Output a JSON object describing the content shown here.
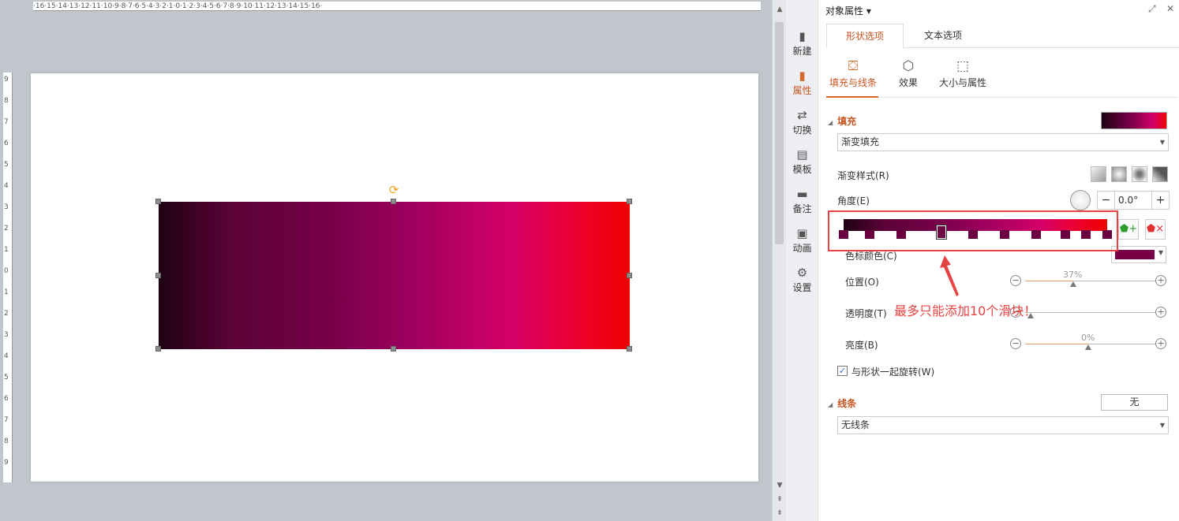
{
  "ruler": {
    "h_ticks": "·16·15·14·13·12·11·10·9·8·7·6·5·4·3·2·1·0·1·2·3·4·5·6·7·8·9·10·11·12·13·14·15·16·",
    "v_ticks": [
      "9",
      "8",
      "7",
      "6",
      "5",
      "4",
      "3",
      "2",
      "1",
      "0",
      "1",
      "2",
      "3",
      "4",
      "5",
      "6",
      "7",
      "8",
      "9"
    ]
  },
  "sidebar": {
    "items": [
      {
        "label": "新建",
        "icon": "new-file-icon"
      },
      {
        "label": "属性",
        "icon": "properties-icon"
      },
      {
        "label": "切换",
        "icon": "transition-icon"
      },
      {
        "label": "模板",
        "icon": "template-icon"
      },
      {
        "label": "备注",
        "icon": "notes-icon"
      },
      {
        "label": "动画",
        "icon": "animation-icon"
      },
      {
        "label": "设置",
        "icon": "settings-icon"
      }
    ]
  },
  "panel": {
    "title": "对象属性",
    "tabs": [
      "形状选项",
      "文本选项"
    ],
    "subtabs": [
      "填充与线条",
      "效果",
      "大小与属性"
    ],
    "fill": {
      "section_title": "填充",
      "type": "渐变填充",
      "style_label": "渐变样式(R)",
      "angle_label": "角度(E)",
      "angle_value": "0.0°",
      "stop_color_label": "色标颜色(C)",
      "position_label": "位置(O)",
      "position_value": "37%",
      "transparency_label": "透明度(T)",
      "brightness_label": "亮度(B)",
      "brightness_value": "0%",
      "rotate_with_shape_label": "与形状一起旋转(W)",
      "rotate_with_shape_checked": true,
      "stop_color": "#7a0045",
      "stops": [
        0,
        10,
        22,
        37,
        49,
        61,
        73,
        84,
        92,
        100
      ]
    },
    "line": {
      "section_title": "线条",
      "button": "无",
      "type": "无线条"
    }
  },
  "annotation": {
    "text": "最多只能添加10个滑块！"
  },
  "colors": {
    "accent": "#c8541f",
    "annotation": "#e84343"
  }
}
